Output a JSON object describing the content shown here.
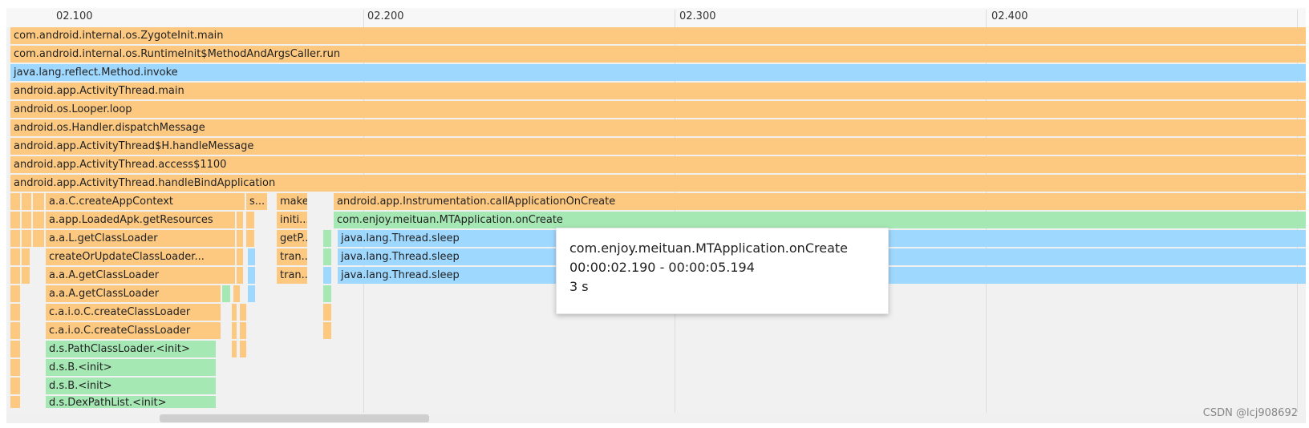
{
  "timeline": {
    "ticks": [
      "02.100",
      "02.200",
      "02.300",
      "02.400"
    ]
  },
  "colors": {
    "orange": "#fdc981",
    "blue": "#9fd8ff",
    "green": "#a5e8b4",
    "track": "#f1f1f1"
  },
  "frames": [
    {
      "label": "com.android.internal.os.ZygoteInit.main",
      "color": "orange"
    },
    {
      "label": "com.android.internal.os.RuntimeInit$MethodAndArgsCaller.run",
      "color": "orange"
    },
    {
      "label": "java.lang.reflect.Method.invoke",
      "color": "blue"
    },
    {
      "label": "android.app.ActivityThread.main",
      "color": "orange"
    },
    {
      "label": "android.os.Looper.loop",
      "color": "orange"
    },
    {
      "label": "android.os.Handler.dispatchMessage",
      "color": "orange"
    },
    {
      "label": "android.app.ActivityThread$H.handleMessage",
      "color": "orange"
    },
    {
      "label": "android.app.ActivityThread.access$1100",
      "color": "orange"
    },
    {
      "label": "android.app.ActivityThread.handleBindApplication",
      "color": "orange"
    },
    {
      "label": "a.a.C.createAppContext",
      "color": "orange"
    },
    {
      "label": "s...",
      "color": "orange"
    },
    {
      "label": "makeA...",
      "color": "orange"
    },
    {
      "label": "android.app.Instrumentation.callApplicationOnCreate",
      "color": "orange"
    },
    {
      "label": "a.app.LoadedApk.getResources",
      "color": "orange"
    },
    {
      "label": "initi...",
      "color": "orange"
    },
    {
      "label": "com.enjoy.meituan.MTApplication.onCreate",
      "color": "green"
    },
    {
      "label": "a.a.L.getClassLoader",
      "color": "orange"
    },
    {
      "label": "getP...",
      "color": "orange"
    },
    {
      "label": "java.lang.Thread.sleep",
      "color": "blue"
    },
    {
      "label": "createOrUpdateClassLoader...",
      "color": "orange"
    },
    {
      "label": "tran...",
      "color": "orange"
    },
    {
      "label": "java.lang.Thread.sleep",
      "color": "blue"
    },
    {
      "label": "a.a.A.getClassLoader",
      "color": "orange"
    },
    {
      "label": "tran...",
      "color": "orange"
    },
    {
      "label": "java.lang.Thread.sleep",
      "color": "blue"
    },
    {
      "label": "a.a.A.getClassLoader",
      "color": "orange"
    },
    {
      "label": "c.a.i.o.C.createClassLoader",
      "color": "orange"
    },
    {
      "label": "c.a.i.o.C.createClassLoader",
      "color": "orange"
    },
    {
      "label": "d.s.PathClassLoader.<init>",
      "color": "green"
    },
    {
      "label": "d.s.B.<init>",
      "color": "green"
    },
    {
      "label": "d.s.B.<init>",
      "color": "green"
    },
    {
      "label": "d.s.DexPathList.<init>",
      "color": "green"
    }
  ],
  "tooltip": {
    "method": "com.enjoy.meituan.MTApplication.onCreate",
    "range": "00:00:02.190 - 00:00:05.194",
    "duration": "3 s"
  },
  "watermark": "CSDN @lcj908692"
}
